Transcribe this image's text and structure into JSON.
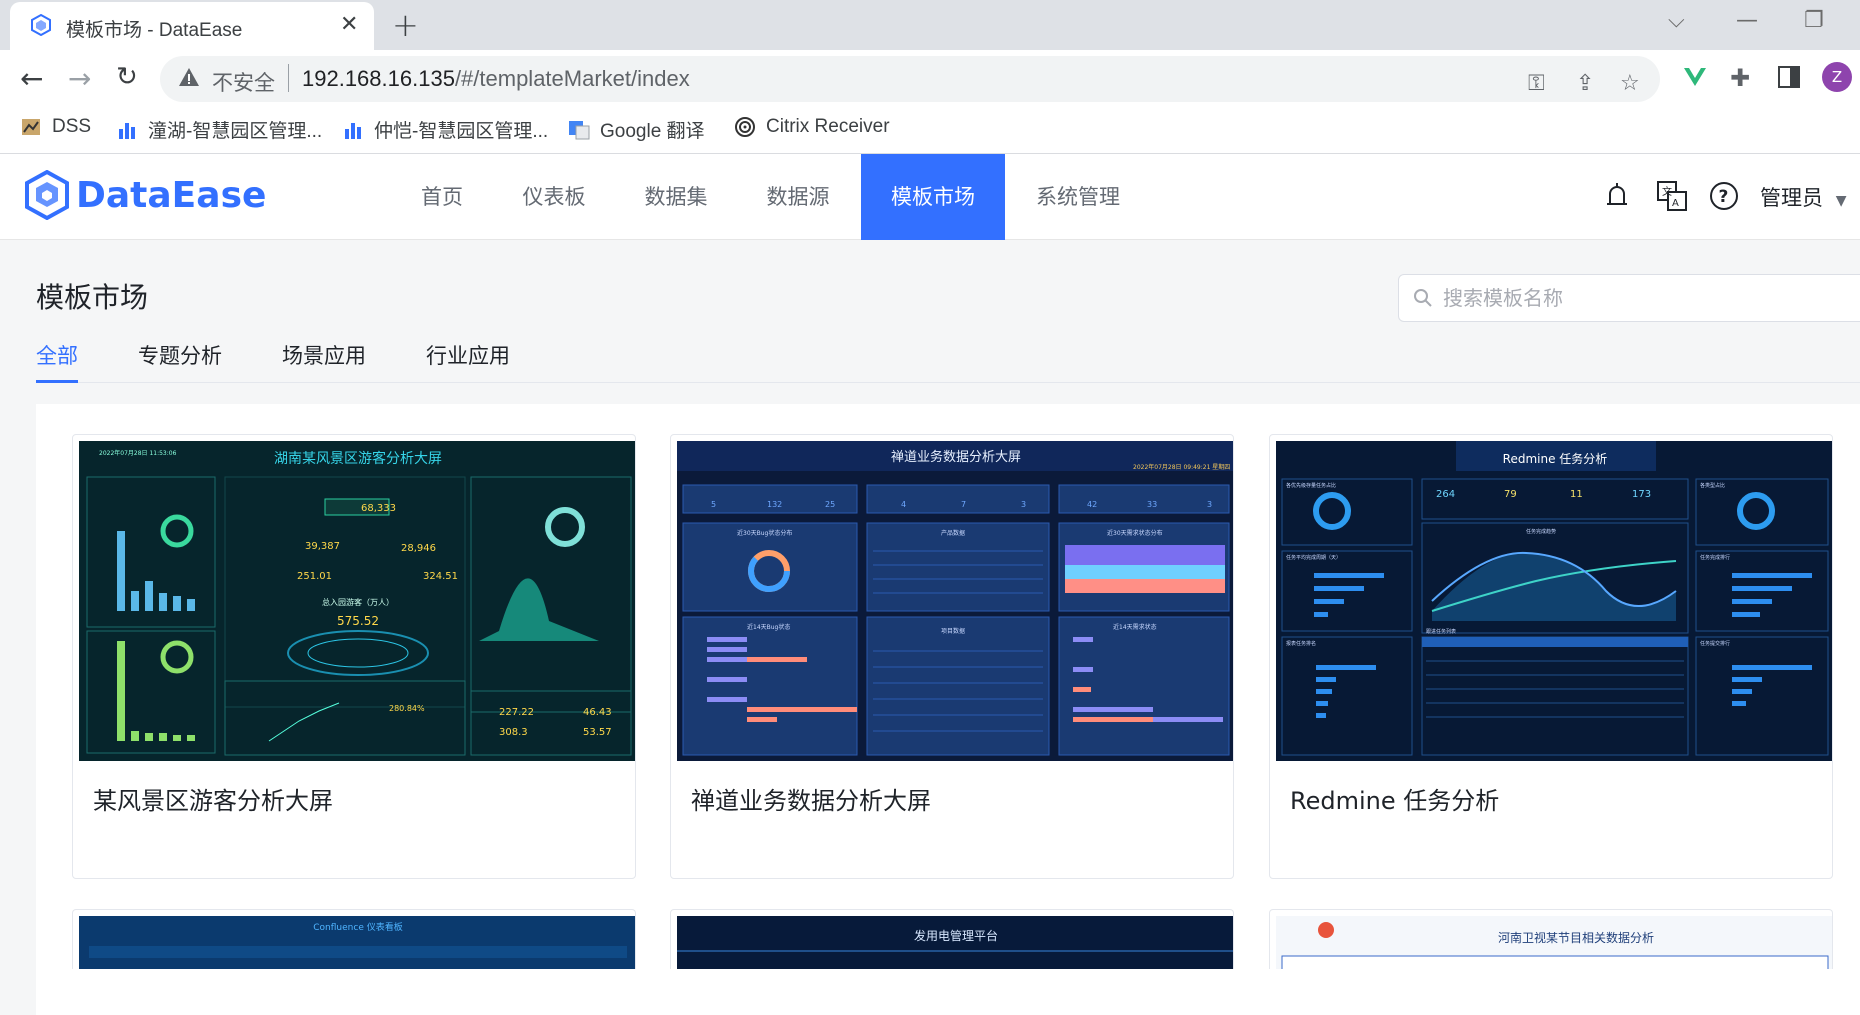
{
  "browser": {
    "tab_title": "模板市场 - DataEase",
    "new_tab_icon": "plus-icon",
    "insecure_label": "不安全",
    "url_host": "192.168.16.135",
    "url_path": "/#/templateMarket/index",
    "avatar_letter": "Z",
    "bookmarks": [
      {
        "label": "DSS",
        "icon": "dss-icon"
      },
      {
        "label": "潼湖-智慧园区管理...",
        "icon": "chart-bars-icon"
      },
      {
        "label": "仲恺-智慧园区管理...",
        "icon": "chart-bars-icon"
      },
      {
        "label": "Google 翻译",
        "icon": "google-translate-icon"
      },
      {
        "label": "Citrix Receiver",
        "icon": "citrix-icon"
      }
    ]
  },
  "app": {
    "logo_text": "DataEase",
    "menu": [
      {
        "label": "首页",
        "active": false
      },
      {
        "label": "仪表板",
        "active": false
      },
      {
        "label": "数据集",
        "active": false
      },
      {
        "label": "数据源",
        "active": false
      },
      {
        "label": "模板市场",
        "active": true
      },
      {
        "label": "系统管理",
        "active": false
      }
    ],
    "user_label": "管理员",
    "accent_color": "#3370ff"
  },
  "page": {
    "title": "模板市场",
    "search_placeholder": "搜索模板名称",
    "tabs": [
      {
        "label": "全部",
        "active": true
      },
      {
        "label": "专题分析",
        "active": false
      },
      {
        "label": "场景应用",
        "active": false
      },
      {
        "label": "行业应用",
        "active": false
      }
    ]
  },
  "templates": [
    {
      "name": "某风景区游客分析大屏",
      "thumb": {
        "title": "湖南某风景区游客分析大屏",
        "date": "2022年07月28日 11:53:06",
        "metrics": [
          "68,333",
          "39,387",
          "28,946",
          "251.01",
          "324.51",
          "575.52",
          "280.84%",
          "227.22",
          "46.43",
          "308.3",
          "53.57"
        ],
        "label_total": "总入园游客（万人）"
      }
    },
    {
      "name": "禅道业务数据分析大屏",
      "thumb": {
        "title": "禅道业务数据分析大屏",
        "date": "2022年07月28日 09:49:21 星期四",
        "kpis": [
          "5",
          "132",
          "25",
          "4",
          "7",
          "3",
          "42",
          "33",
          "3"
        ],
        "panels": [
          "近30天Bug状态分布",
          "产品数据",
          "近30天需求状态分布",
          "近14天Bug状态",
          "项目数据",
          "近14天需求状态"
        ]
      }
    },
    {
      "name": "Redmine 任务分析",
      "thumb": {
        "title": "Redmine 任务分析",
        "kpis": [
          "264",
          "79",
          "11",
          "173"
        ],
        "panels": [
          "各优先级存量任务占比",
          "任务完成趋势",
          "各类型占比",
          "任务平均完成周期（天）",
          "任务完成排行",
          "报表任务排名",
          "跟进任务列表",
          "任务提交排行"
        ]
      }
    },
    {
      "name": "",
      "thumb": {
        "title": "Confluence 仪表看板"
      }
    },
    {
      "name": "",
      "thumb": {
        "title": "发用电管理平台"
      }
    },
    {
      "name": "",
      "thumb": {
        "title": "河南卫视某节目相关数据分析"
      }
    }
  ]
}
